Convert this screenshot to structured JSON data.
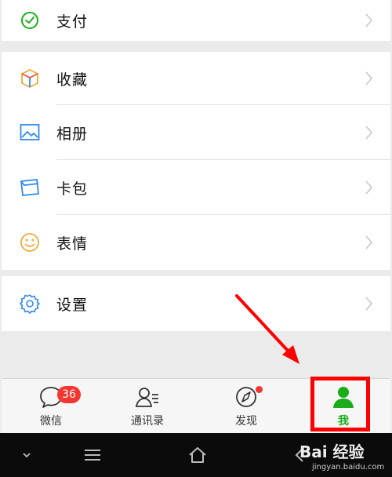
{
  "menu": {
    "pay": {
      "label": "支付",
      "icon": "wallet-icon"
    },
    "favorites": {
      "label": "收藏",
      "icon": "cube-icon"
    },
    "album": {
      "label": "相册",
      "icon": "photo-icon"
    },
    "cards": {
      "label": "卡包",
      "icon": "card-icon"
    },
    "stickers": {
      "label": "表情",
      "icon": "smiley-icon"
    },
    "settings": {
      "label": "设置",
      "icon": "gear-icon"
    }
  },
  "tabbar": {
    "wechat": {
      "label": "微信",
      "badge": "36",
      "icon": "chat-icon"
    },
    "contacts": {
      "label": "通讯录",
      "icon": "contacts-icon"
    },
    "discover": {
      "label": "发现",
      "icon": "compass-icon"
    },
    "me": {
      "label": "我",
      "icon": "person-icon"
    }
  },
  "watermark": {
    "text": "Bai 经验",
    "url": "jingyan.baidu.com"
  },
  "colors": {
    "accent_green": "#1aad19",
    "badge_red": "#f43530",
    "annotation_red": "#ff0000",
    "icon_blue": "#2f89f0"
  }
}
